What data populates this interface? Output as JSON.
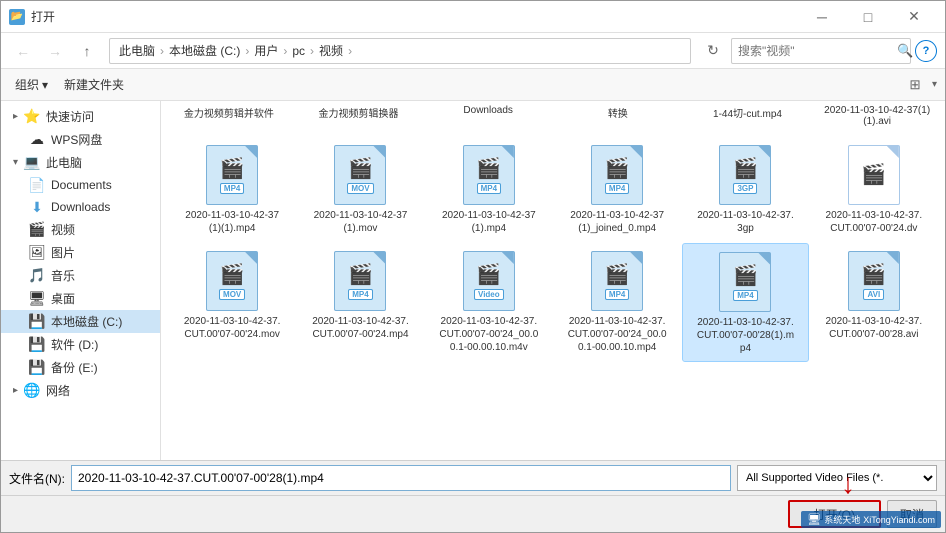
{
  "window": {
    "title": "打开",
    "close_btn": "✕",
    "min_btn": "─",
    "max_btn": "□"
  },
  "toolbar": {
    "back_tooltip": "后退",
    "forward_tooltip": "前进",
    "up_tooltip": "向上",
    "address": {
      "parts": [
        "此电脑",
        "本地磁盘 (C:)",
        "用户",
        "pc",
        "视频"
      ],
      "separator": "›"
    },
    "search_placeholder": "搜索\"视频\"",
    "refresh_tooltip": "刷新"
  },
  "toolbar2": {
    "organize_label": "组织",
    "newfolder_label": "新建文件夹"
  },
  "sidebar": {
    "items": [
      {
        "id": "quick-access",
        "label": "快速访问",
        "icon": "⚡",
        "indent": 0
      },
      {
        "id": "wps-drive",
        "label": "WPS网盘",
        "icon": "☁",
        "indent": 1
      },
      {
        "id": "this-pc",
        "label": "此电脑",
        "icon": "💻",
        "indent": 0
      },
      {
        "id": "documents",
        "label": "Documents",
        "icon": "📄",
        "indent": 2
      },
      {
        "id": "downloads",
        "label": "Downloads",
        "icon": "⬇",
        "indent": 2
      },
      {
        "id": "videos",
        "label": "视频",
        "icon": "🎬",
        "indent": 2
      },
      {
        "id": "pictures",
        "label": "图片",
        "icon": "🖼",
        "indent": 2
      },
      {
        "id": "music",
        "label": "音乐",
        "icon": "🎵",
        "indent": 2
      },
      {
        "id": "desktop",
        "label": "桌面",
        "icon": "🖥",
        "indent": 2
      },
      {
        "id": "local-disk-c",
        "label": "本地磁盘 (C:)",
        "icon": "💾",
        "indent": 1,
        "selected": true
      },
      {
        "id": "software-d",
        "label": "软件 (D:)",
        "icon": "💾",
        "indent": 1
      },
      {
        "id": "backup-e",
        "label": "备份 (E:)",
        "icon": "💾",
        "indent": 1
      },
      {
        "id": "network",
        "label": "网络",
        "icon": "🌐",
        "indent": 0
      }
    ]
  },
  "top_labels": [
    "金力视频剪辑并软件",
    "金力视频剪辑换器",
    "Downloads",
    "转换",
    "1-44切-cut.mp4",
    "2020-11-03-10-42-37(1) (1).avi"
  ],
  "files": [
    {
      "name": "2020-11-03-10-42-37(1)(1).mp4",
      "type": "MP4",
      "blue": true,
      "selected": false
    },
    {
      "name": "2020-11-03-10-42-37(1).mov",
      "type": "MOV",
      "blue": true,
      "selected": false
    },
    {
      "name": "2020-11-03-10-42-37(1).mp4",
      "type": "MP4",
      "blue": true,
      "selected": false
    },
    {
      "name": "2020-11-03-10-42-37(1)_joined_0.mp4",
      "type": "MP4",
      "blue": true,
      "selected": false
    },
    {
      "name": "2020-11-03-10-42-37.3gp",
      "type": "3GP",
      "blue": true,
      "selected": false
    },
    {
      "name": "2020-11-03-10-42-37.CUT.00'07-00'24.dv",
      "type": "",
      "blue": false,
      "selected": false
    },
    {
      "name": "2020-11-03-10-42-37.CUT.00'07-00'24.mov",
      "type": "MOV",
      "blue": true,
      "selected": false
    },
    {
      "name": "2020-11-03-10-42-37.CUT.00'07-00'24.mp4",
      "type": "MP4",
      "blue": true,
      "selected": false
    },
    {
      "name": "2020-11-03-10-42-37.CUT.00'07-00'24_00.00.1-00.00.10.m4v",
      "type": "Video",
      "blue": true,
      "selected": false
    },
    {
      "name": "2020-11-03-10-42-37.CUT.00'07-00'24_00.00.1-00.00.10.mp4",
      "type": "MP4",
      "blue": true,
      "selected": false
    },
    {
      "name": "2020-11-03-10-42-37.CUT.00'07-00'28(1).mp4",
      "type": "MP4",
      "blue": true,
      "selected": true
    },
    {
      "name": "2020-11-03-10-42-37.CUT.00'07-00'28.avi",
      "type": "AVI",
      "blue": true,
      "selected": false
    }
  ],
  "bottom": {
    "filename_label": "文件名(N):",
    "filename_value": "2020-11-03-10-42-37.CUT.00'07-00'28(1).mp4",
    "filetype_label": "All Supported Video Files (*.",
    "open_label": "打开(O)",
    "cancel_label": "取消"
  },
  "watermark": {
    "text": "XiTongYiandi.com",
    "brand": "系统天地"
  }
}
